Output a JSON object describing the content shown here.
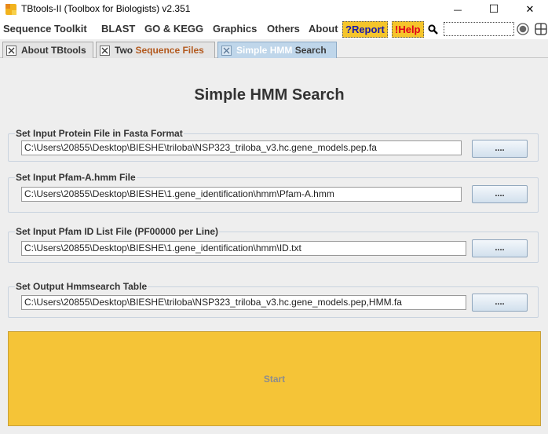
{
  "window": {
    "title": "TBtools-II (Toolbox for Biologists) v2.351",
    "minimize_glyph": "—",
    "maximize_glyph": "☐",
    "close_glyph": "✕"
  },
  "menu": {
    "items": [
      "Sequence Toolkit",
      "BLAST",
      "GO & KEGG",
      "Graphics",
      "Others",
      "About"
    ],
    "report_label": "?Report",
    "help_label": "!Help",
    "search_icon": "search-icon",
    "accent_color": "#f5c52b",
    "help_color": "#e0001a",
    "report_color": "#1a1aa8"
  },
  "tabs": [
    {
      "prefix": "About TBtools",
      "accent": "",
      "active": false
    },
    {
      "prefix": "Two ",
      "accent": "Sequence Files",
      "active": false
    },
    {
      "prefix": "Simple ",
      "accent": "HMM",
      "suffix": " Search",
      "active": true
    }
  ],
  "page": {
    "title": "Simple HMM Search",
    "groups": [
      {
        "title": "Set Input Protein File in Fasta Format",
        "value": "C:\\Users\\20855\\Desktop\\BIESHE\\triloba\\NSP323_triloba_v3.hc.gene_models.pep.fa",
        "button": "...."
      },
      {
        "title": "Set Input Pfam-A.hmm File",
        "value": "C:\\Users\\20855\\Desktop\\BIESHE\\1.gene_identification\\hmm\\Pfam-A.hmm",
        "button": "...."
      },
      {
        "title": "Set Input Pfam ID List File (PF00000 per Line)",
        "value": "C:\\Users\\20855\\Desktop\\BIESHE\\1.gene_identification\\hmm\\ID.txt",
        "button": "...."
      },
      {
        "title": "Set Output Hmmsearch Table",
        "value": "C:\\Users\\20855\\Desktop\\BIESHE\\triloba\\NSP323_triloba_v3.hc.gene_models.pep,HMM.fa",
        "button": "...."
      }
    ],
    "start_label": "Start",
    "start_color": "#f5c437"
  }
}
